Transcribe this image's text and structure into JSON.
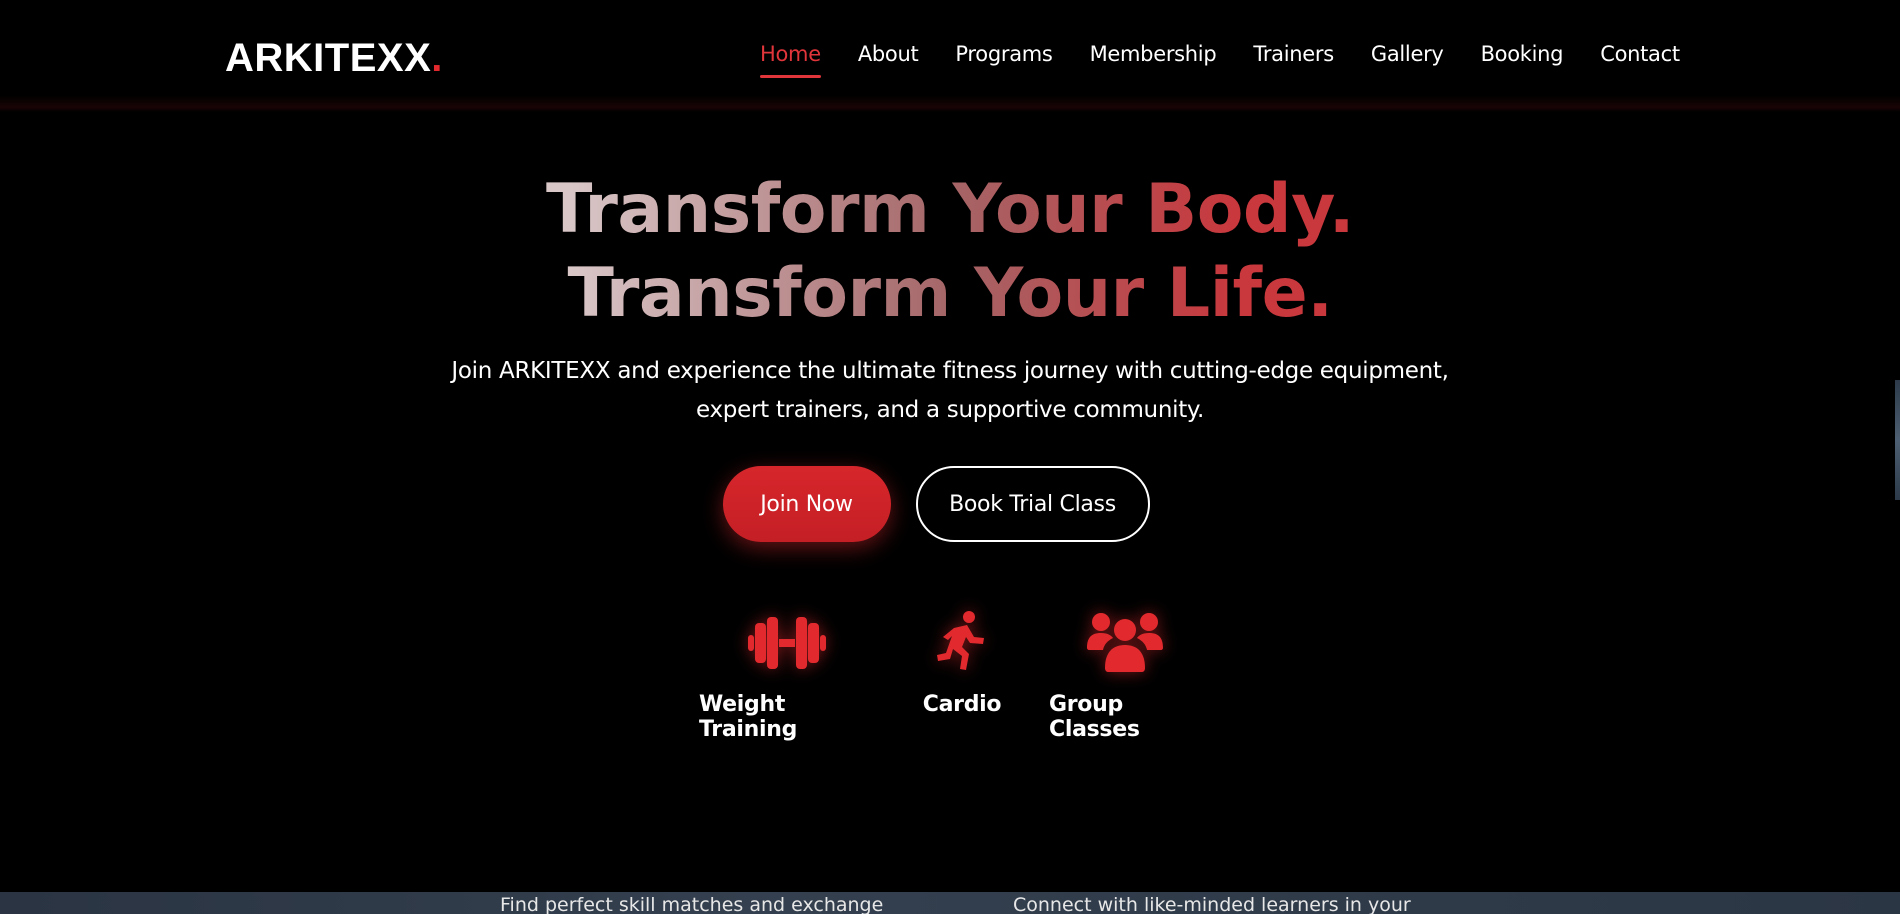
{
  "brand": {
    "name": "ARKITEXX",
    "dot": "."
  },
  "nav": {
    "items": [
      {
        "label": "Home",
        "active": true
      },
      {
        "label": "About"
      },
      {
        "label": "Programs"
      },
      {
        "label": "Membership"
      },
      {
        "label": "Trainers"
      },
      {
        "label": "Gallery"
      },
      {
        "label": "Booking"
      },
      {
        "label": "Contact"
      }
    ]
  },
  "hero": {
    "headline_line1": "Transform Your Body.",
    "headline_line2": "Transform Your Life.",
    "subtitle_line1": "Join ARKITEXX and experience the ultimate fitness journey with cutting-edge equipment,",
    "subtitle_line2": "expert trainers, and a supportive community.",
    "primary_button": "Join Now",
    "secondary_button": "Book Trial Class"
  },
  "features": [
    {
      "icon": "dumbbell-icon",
      "label": "Weight Training"
    },
    {
      "icon": "running-icon",
      "label": "Cardio"
    },
    {
      "icon": "users-icon",
      "label": "Group Classes"
    }
  ],
  "next_section": {
    "left_text": "Find perfect skill matches and exchange",
    "right_text": "Connect with like-minded learners in your"
  },
  "colors": {
    "accent": "#e22a2e",
    "background": "#000000",
    "text": "#ffffff"
  }
}
